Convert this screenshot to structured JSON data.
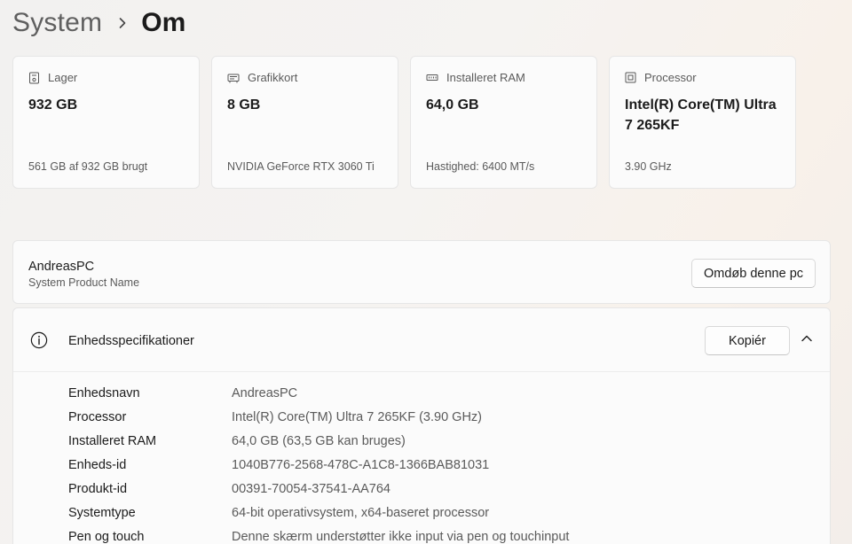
{
  "breadcrumb": {
    "parent": "System",
    "current": "Om"
  },
  "cards": [
    {
      "icon": "storage-icon",
      "label": "Lager",
      "value": "932 GB",
      "sub": "561 GB af 932 GB brugt"
    },
    {
      "icon": "graphics-card-icon",
      "label": "Grafikkort",
      "value": "8 GB",
      "sub": "NVIDIA GeForce RTX 3060 Ti"
    },
    {
      "icon": "ram-icon",
      "label": "Installeret RAM",
      "value": "64,0 GB",
      "sub": "Hastighed: 6400 MT/s"
    },
    {
      "icon": "processor-icon",
      "label": "Processor",
      "value": "Intel(R) Core(TM) Ultra 7 265KF",
      "sub": "3.90 GHz"
    }
  ],
  "device": {
    "name": "AndreasPC",
    "subtitle": "System Product Name",
    "rename_label": "Omdøb denne pc"
  },
  "specs": {
    "title": "Enhedsspecifikationer",
    "copy_label": "Kopiér",
    "rows": [
      {
        "key": "Enhedsnavn",
        "value": "AndreasPC"
      },
      {
        "key": "Processor",
        "value": "Intel(R) Core(TM) Ultra 7 265KF (3.90 GHz)"
      },
      {
        "key": "Installeret RAM",
        "value": "64,0 GB (63,5 GB kan bruges)"
      },
      {
        "key": "Enheds-id",
        "value": "1040B776-2568-478C-A1C8-1366BAB81031"
      },
      {
        "key": "Produkt-id",
        "value": "00391-70054-37541-AA764"
      },
      {
        "key": "Systemtype",
        "value": "64-bit operativsystem, x64-baseret processor"
      },
      {
        "key": "Pen og touch",
        "value": "Denne skærm understøtter ikke input via pen og touchinput"
      }
    ]
  }
}
